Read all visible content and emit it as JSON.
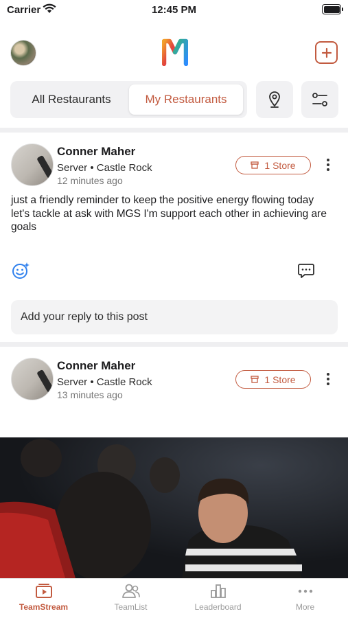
{
  "status_bar": {
    "carrier": "Carrier",
    "time": "12:45 PM"
  },
  "header": {
    "logo_letter": "M"
  },
  "filters": {
    "all_label": "All Restaurants",
    "my_label": "My Restaurants",
    "active": "My Restaurants"
  },
  "posts": [
    {
      "author": "Conner Maher",
      "role": "Server • Castle Rock",
      "time_ago": "12 minutes ago",
      "store_badge": "1 Store",
      "body": "just a friendly reminder to keep the positive energy flowing today let's tackle at ask with MGS I'm support each other in achieving are goals",
      "reply_placeholder": "Add your reply to this post"
    },
    {
      "author": "Conner Maher",
      "role": "Server • Castle Rock",
      "time_ago": "13 minutes ago",
      "store_badge": "1 Store"
    }
  ],
  "tabs": [
    {
      "label": "TeamStream",
      "icon": "play-icon",
      "active": true
    },
    {
      "label": "TeamList",
      "icon": "people-icon",
      "active": false
    },
    {
      "label": "Leaderboard",
      "icon": "bar-chart-icon",
      "active": false
    },
    {
      "label": "More",
      "icon": "ellipsis-icon",
      "active": false
    }
  ],
  "colors": {
    "accent": "#c25a3f",
    "reaction_blue": "#2f80ed"
  }
}
